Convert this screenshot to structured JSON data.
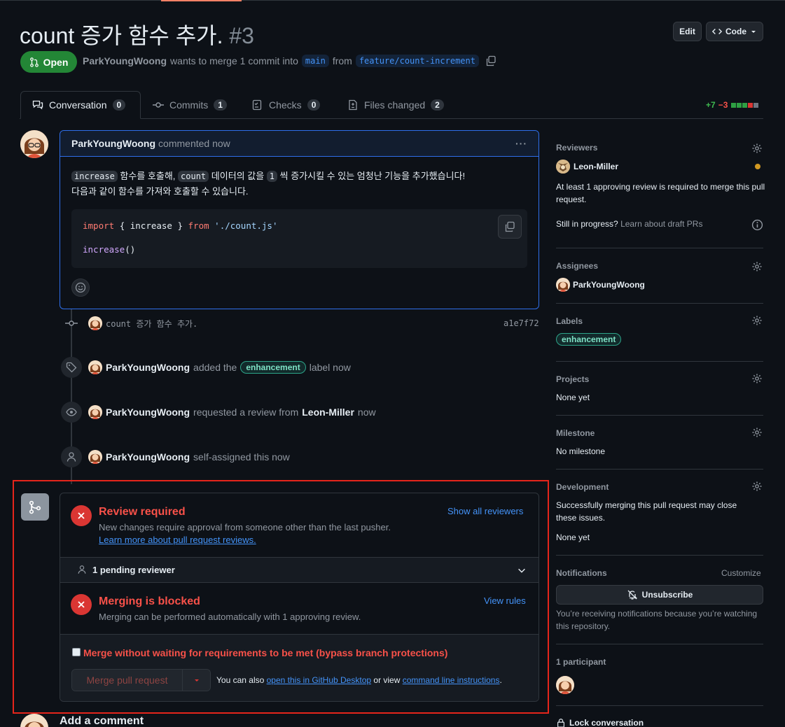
{
  "header": {
    "title": "count 증가 함수 추가.",
    "number": "#3",
    "edit_label": "Edit",
    "code_label": "Code",
    "state_label": "Open",
    "author": "ParkYoungWoong",
    "merge_text": "wants to merge 1 commit into",
    "base_branch": "main",
    "from_text": "from",
    "head_branch": "feature/count-increment"
  },
  "tabs": [
    {
      "label": "Conversation",
      "count": "0"
    },
    {
      "label": "Commits",
      "count": "1"
    },
    {
      "label": "Checks",
      "count": "0"
    },
    {
      "label": "Files changed",
      "count": "2"
    }
  ],
  "diffstat": {
    "additions": "+7",
    "deletions": "−3",
    "colors": {
      "add": "#2ea043",
      "del": "#da3633",
      "neutral": "#6e7681"
    }
  },
  "comment": {
    "author": "ParkYoungWoong",
    "action": "commented now",
    "more_label": "···",
    "line1": {
      "code1": "increase",
      "text1": "함수를 호출해,",
      "code2": "count",
      "text2": "데이터의 값을",
      "code3": "1",
      "text3": "씩 증가시킬 수 있는 엄청난 기능을 추가했습니다!"
    },
    "line2": "다음과 같이 함수를 가져와 호출할 수 있습니다.",
    "code": {
      "import_kw": "import",
      "brace_open": "{ increase }",
      "from_kw": "from",
      "path": "'./count.js'",
      "call_fn": "increase",
      "call_parens": "()"
    }
  },
  "timeline": {
    "commit_message": "count 증가 함수 추가.",
    "commit_sha": "a1e7f72",
    "events": [
      {
        "author": "ParkYoungWoong",
        "pre": "added the",
        "label": "enhancement",
        "post": "label now"
      },
      {
        "author": "ParkYoungWoong",
        "pre": "requested a review from",
        "target": "Leon-Miller",
        "post": "now"
      },
      {
        "author": "ParkYoungWoong",
        "pre": "self-assigned this now"
      }
    ]
  },
  "merge": {
    "review_title": "Review required",
    "review_sub": "New changes require approval from someone other than the last pusher.",
    "review_link": "Learn more about pull request reviews.",
    "show_reviewers": "Show all reviewers",
    "pending": "1 pending reviewer",
    "blocked_title": "Merging is blocked",
    "blocked_sub": "Merging can be performed automatically with 1 approving review.",
    "view_rules": "View rules",
    "bypass_label": "Merge without waiting for requirements to be met (bypass branch protections)",
    "merge_button": "Merge pull request",
    "also_text": "You can also",
    "desktop_link": "open this in GitHub Desktop",
    "or_view": "or view",
    "cli_link": "command line instructions",
    "period": "."
  },
  "add_comment": "Add a comment",
  "sidebar": {
    "reviewers": {
      "title": "Reviewers",
      "name": "Leon-Miller",
      "note": "At least 1 approving review is required to merge this pull request.",
      "progress_q": "Still in progress?",
      "progress_link": "Learn about draft PRs"
    },
    "assignees": {
      "title": "Assignees",
      "name": "ParkYoungWoong"
    },
    "labels": {
      "title": "Labels",
      "label": "enhancement"
    },
    "projects": {
      "title": "Projects",
      "value": "None yet"
    },
    "milestone": {
      "title": "Milestone",
      "value": "No milestone"
    },
    "development": {
      "title": "Development",
      "text": "Successfully merging this pull request may close these issues.",
      "value": "None yet"
    },
    "notifications": {
      "title": "Notifications",
      "customize": "Customize",
      "button": "Unsubscribe",
      "text": "You’re receiving notifications because you’re watching this repository."
    },
    "participants": {
      "title": "1 participant"
    },
    "lock": "Lock conversation"
  }
}
